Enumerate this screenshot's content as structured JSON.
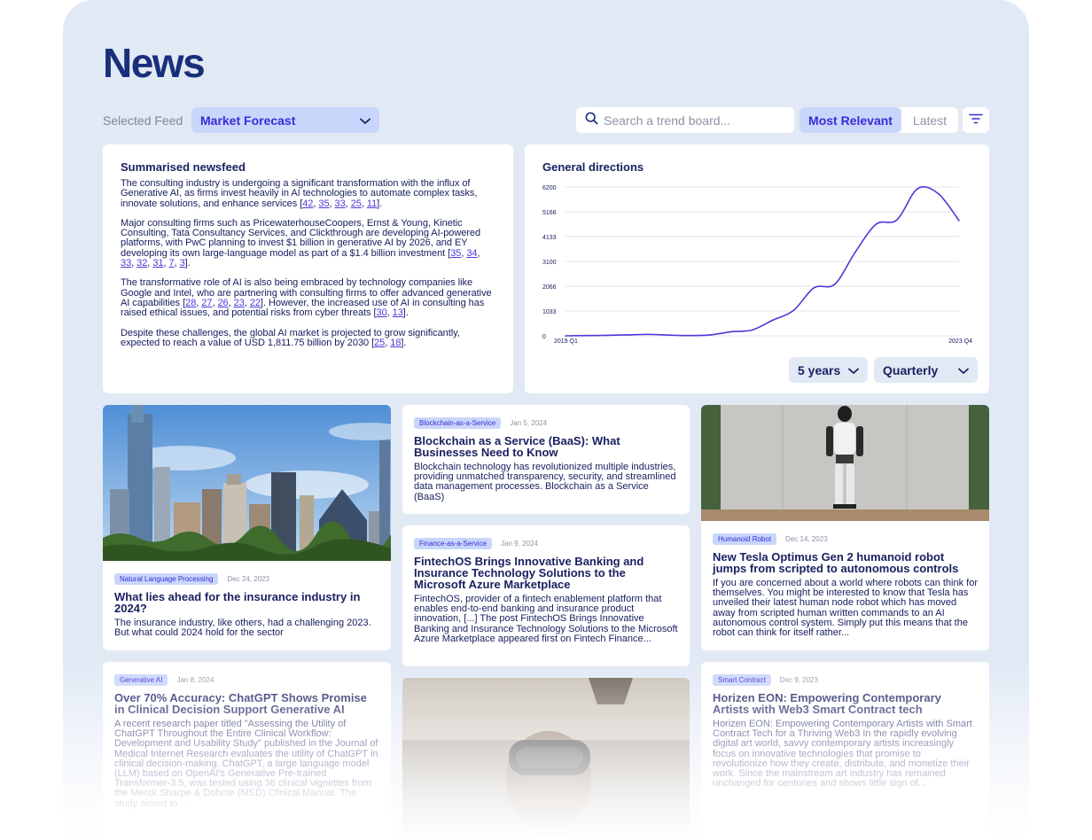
{
  "page": {
    "title": "News"
  },
  "feed": {
    "label": "Selected Feed",
    "value": "Market Forecast"
  },
  "search": {
    "placeholder": "Search a trend board..."
  },
  "sort": {
    "active": "Most Relevant",
    "inactive": "Latest"
  },
  "summary": {
    "heading": "Summarised newsfeed",
    "paragraphs": [
      {
        "text": "The consulting industry is undergoing a significant transformation with the influx of Generative AI, as firms invest heavily in AI technologies to automate complex tasks, innovate solutions, and enhance services ",
        "cites": [
          "42",
          "35",
          "33",
          "25",
          "11"
        ],
        "end": "."
      },
      {
        "text": "Major consulting firms such as PricewaterhouseCoopers, Ernst & Young, Kinetic Consulting, Tata Consultancy Services, and Clickthrough are developing AI-powered platforms, with PwC planning to invest $1 billion in generative AI by 2026, and EY developing its own large-language model as part of a $1.4 billion investment ",
        "cites": [
          "35",
          "34",
          "33",
          "32",
          "31",
          "7",
          "3"
        ],
        "end": "."
      },
      {
        "text": "The transformative role of AI is also being embraced by technology companies like Google and Intel, who are partnering with consulting firms to offer advanced generative AI capabilities ",
        "cites": [
          "28",
          "27",
          "26",
          "23",
          "22"
        ],
        "end": ". However, the increased use of AI in consulting has raised ethical issues, and potential risks from cyber threats ",
        "cites2": [
          "30",
          "13"
        ],
        "end2": "."
      },
      {
        "text": "Despite these challenges, the global AI market is projected to grow significantly, expected to reach a value of USD 1,811.75 billion by 2030 ",
        "cites": [
          "25",
          "18"
        ],
        "end": "."
      }
    ]
  },
  "chart": {
    "heading": "General directions",
    "range_label": "5 years",
    "interval_label": "Quarterly"
  },
  "chart_data": {
    "type": "line",
    "title": "General directions",
    "x_start_label": "2019 Q1",
    "x_end_label": "2023 Q4",
    "y_ticks": [
      0,
      1033,
      2066,
      3100,
      4133,
      5166,
      6200
    ],
    "ylim": [
      0,
      6200
    ],
    "grid": true,
    "x": [
      "2019 Q1",
      "2019 Q2",
      "2019 Q3",
      "2019 Q4",
      "2020 Q1",
      "2020 Q2",
      "2020 Q3",
      "2020 Q4",
      "2021 Q1",
      "2021 Q2",
      "2021 Q3",
      "2021 Q4",
      "2022 Q1",
      "2022 Q2",
      "2022 Q3",
      "2022 Q4",
      "2023 Q1",
      "2023 Q2",
      "2023 Q3",
      "2023 Q4"
    ],
    "values": [
      0,
      10,
      20,
      40,
      60,
      30,
      10,
      40,
      170,
      240,
      650,
      1050,
      2000,
      2150,
      3500,
      4650,
      4830,
      6130,
      5920,
      4800
    ]
  },
  "articles": [
    {
      "tag": "Natural Language Processing",
      "date": "Dec 24, 2023",
      "title": "What lies ahead for the insurance industry in 2024?",
      "body": "The insurance industry, like others, had a challenging 2023. But what could 2024 hold for the sector"
    },
    {
      "tag": "Blockchain-as-a-Service",
      "date": "Jan 5, 2024",
      "title": "Blockchain as a Service (BaaS): What Businesses Need to Know",
      "body": "Blockchain technology has revolutionized multiple industries, providing unmatched transparency, security, and streamlined data management processes. Blockchain as a Service (BaaS)"
    },
    {
      "tag": "Finance-as-a-Service",
      "date": "Jan 9, 2024",
      "title": "FintechOS Brings Innovative Banking and Insurance Technology Solutions to the Microsoft Azure Marketplace",
      "body": "FintechOS, provider of a fintech enablement platform that enables end-to-end banking and insurance product innovation, [...] The post FintechOS Brings Innovative Banking and Insurance Technology Solutions to the Microsoft Azure Marketplace appeared first on Fintech Finance..."
    },
    {
      "tag": "Humanoid Robot",
      "date": "Dec 14, 2023",
      "title": "New Tesla Optimus Gen 2 humanoid robot jumps from scripted to autonomous controls",
      "body": "If you are concerned about a world where robots can think for themselves. You might be interested to know that Tesla has unveiled their latest human node robot which has moved away from scripted human written commands to an AI autonomous control system. Simply put this means that the robot can think for itself rather..."
    },
    {
      "tag": "Generative AI",
      "date": "Jan 8, 2024",
      "title": "Over 70% Accuracy: ChatGPT Shows Promise in Clinical Decision Support Generative AI",
      "body": "A recent research paper titled \"Assessing the Utility of ChatGPT Throughout the Entire Clinical Workflow: Development and Usability Study\" published in the Journal of Medical Internet Research evaluates the utility of ChatGPT in clinical decision-making. ChatGPT, a large language model (LLM) based on OpenAI's Generative Pre-trained Transformer-3.5, was tested using 36 clinical vignettes from the Merck Sharpe & Dohme (MSD) Clinical Manual. The study aimed to..."
    },
    {
      "tag": "Smart Contract",
      "date": "Dec 9, 2023",
      "title": "Horizen EON: Empowering Contemporary Artists with Web3 Smart Contract tech",
      "body": "Horizen EON: Empowering Contemporary Artists with Smart Contract Tech for a Thriving Web3 In the rapidly evolving digital art world, savvy contemporary artists increasingly focus on innovative technologies that promise to revolutionize how they create, distribute, and monetize their work. Since the mainstream art industry has remained unchanged for centuries and shows little sign of..."
    }
  ],
  "colors": {
    "accent": "#3a2bd8",
    "accent_bg": "#c9d6fb",
    "page_bg": "#e1e9f5",
    "text": "#1a2160",
    "line": "#4b38d9"
  },
  "icons": {
    "search": "search-icon",
    "filter": "filter-icon",
    "chevron": "chevron-down-icon"
  }
}
